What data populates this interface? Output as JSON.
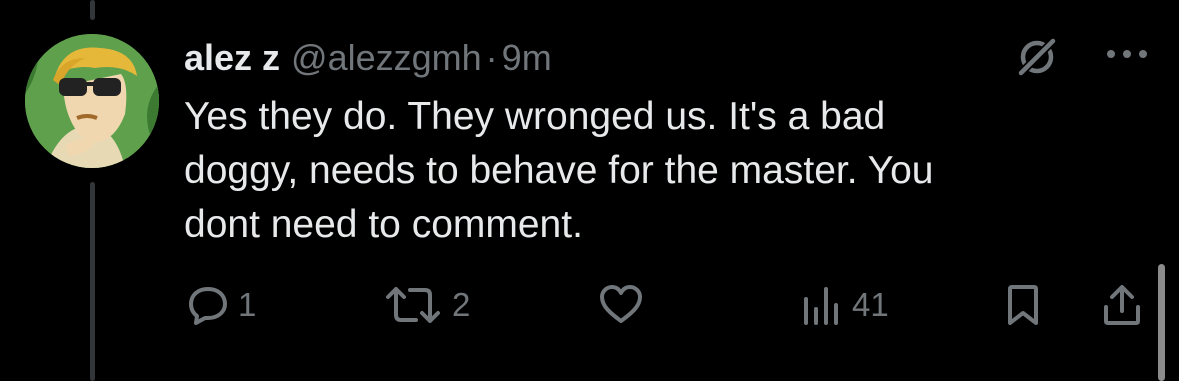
{
  "tweet": {
    "display_name": "alez z",
    "handle": "@alezzgmh",
    "separator": "·",
    "time": "9m",
    "text": "Yes they do. They wronged us. It's a bad\ndoggy, needs to behave for the master. You\ndont need to comment."
  },
  "actions": {
    "reply_count": "1",
    "repost_count": "2",
    "views_count": "41"
  },
  "icons": {
    "reply": "reply-icon",
    "repost": "repost-icon",
    "like": "heart-icon",
    "views": "views-icon",
    "bookmark": "bookmark-icon",
    "share": "share-icon",
    "grok": "grok-icon",
    "more": "more-icon"
  },
  "colors": {
    "background": "#000000",
    "text": "#e7e9ea",
    "secondary": "#71767b",
    "thread_line": "#333639"
  }
}
